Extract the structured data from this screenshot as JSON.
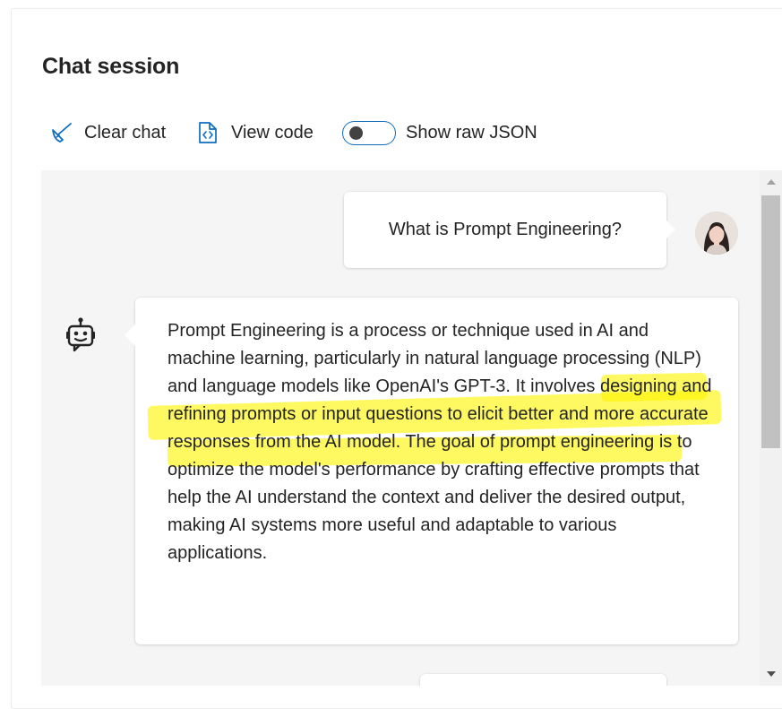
{
  "header": {
    "title": "Chat session"
  },
  "toolbar": {
    "clear_label": "Clear chat",
    "view_code_label": "View code",
    "raw_json_label": "Show raw JSON",
    "raw_json_on": false
  },
  "messages": [
    {
      "role": "user",
      "text": "What is Prompt Engineering?",
      "icon": "user-avatar"
    },
    {
      "role": "assistant",
      "icon": "bot-icon",
      "text": "Prompt Engineering is a process or technique used in AI and machine learning, particularly in natural language processing (NLP) and language models like OpenAI's GPT-3. It involves designing and refining prompts or input questions to elicit better and more accurate responses from the AI model. The goal of prompt engineering is to optimize the model's performance by crafting effective prompts that help the AI understand the context and deliver the desired output, making AI systems more useful and adaptable to various applications.",
      "highlighted_text": "It involves designing and refining prompts or input questions to elicit better and more accurate responses from the AI model.",
      "highlight_color": "#fff200"
    }
  ],
  "colors": {
    "accent": "#0f6cbd",
    "chat_background": "#f5f5f5",
    "bubble_background": "#ffffff",
    "text": "#242424"
  }
}
